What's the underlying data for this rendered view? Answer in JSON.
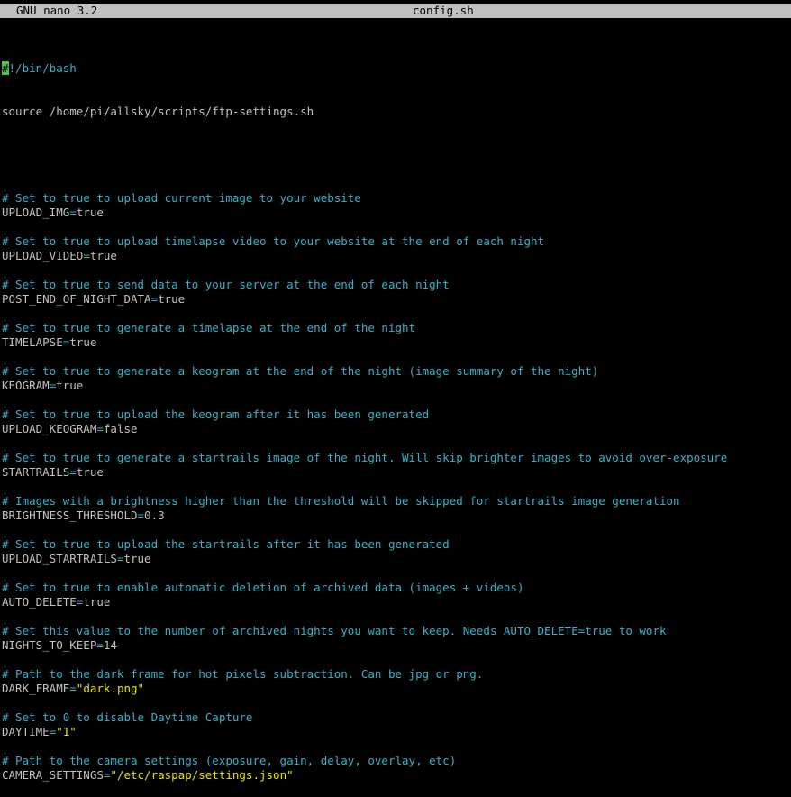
{
  "titlebar": {
    "app_name": "GNU nano 3.2",
    "file_name": "config.sh"
  },
  "editor": {
    "shebang_cursor": "#",
    "shebang_rest": "!/bin/bash",
    "source_line": "source /home/pi/allsky/scripts/ftp-settings.sh",
    "lines": [
      {
        "comment": "# Set to true to upload current image to your website"
      },
      {
        "key": "UPLOAD_IMG",
        "value": "true"
      },
      {
        "blank": true
      },
      {
        "comment": "# Set to true to upload timelapse video to your website at the end of each night"
      },
      {
        "key": "UPLOAD_VIDEO",
        "value": "true"
      },
      {
        "blank": true
      },
      {
        "comment": "# Set to true to send data to your server at the end of each night"
      },
      {
        "key": "POST_END_OF_NIGHT_DATA",
        "value": "true"
      },
      {
        "blank": true
      },
      {
        "comment": "# Set to true to generate a timelapse at the end of the night"
      },
      {
        "key": "TIMELAPSE",
        "value": "true"
      },
      {
        "blank": true
      },
      {
        "comment": "# Set to true to generate a keogram at the end of the night (image summary of the night)"
      },
      {
        "key": "KEOGRAM",
        "value": "true"
      },
      {
        "blank": true
      },
      {
        "comment": "# Set to true to upload the keogram after it has been generated"
      },
      {
        "key": "UPLOAD_KEOGRAM",
        "value": "false"
      },
      {
        "blank": true
      },
      {
        "comment": "# Set to true to generate a startrails image of the night. Will skip brighter images to avoid over-exposure"
      },
      {
        "key": "STARTRAILS",
        "value": "true"
      },
      {
        "blank": true
      },
      {
        "comment": "# Images with a brightness higher than the threshold will be skipped for startrails image generation"
      },
      {
        "key": "BRIGHTNESS_THRESHOLD",
        "value": "0.3"
      },
      {
        "blank": true
      },
      {
        "comment": "# Set to true to upload the startrails after it has been generated"
      },
      {
        "key": "UPLOAD_STARTRAILS",
        "value": "true"
      },
      {
        "blank": true
      },
      {
        "comment": "# Set to true to enable automatic deletion of archived data (images + videos)"
      },
      {
        "key": "AUTO_DELETE",
        "value": "true"
      },
      {
        "blank": true
      },
      {
        "comment": "# Set this value to the number of archived nights you want to keep. Needs AUTO_DELETE=true to work"
      },
      {
        "key": "NIGHTS_TO_KEEP",
        "value": "14"
      },
      {
        "blank": true
      },
      {
        "comment": "# Path to the dark frame for hot pixels subtraction. Can be jpg or png."
      },
      {
        "key": "DARK_FRAME",
        "value": "\"dark.png\"",
        "string": true
      },
      {
        "blank": true
      },
      {
        "comment": "# Set to 0 to disable Daytime Capture"
      },
      {
        "key": "DAYTIME",
        "value": "\"1\"",
        "string": true
      },
      {
        "blank": true
      },
      {
        "comment": "# Path to the camera settings (exposure, gain, delay, overlay, etc)"
      },
      {
        "key": "CAMERA_SETTINGS",
        "value": "\"/etc/raspap/settings.json\"",
        "string": true
      }
    ]
  },
  "colors": {
    "background": "#000000",
    "titlebar": "#c0c0c0",
    "text": "#c0c0c0",
    "comment": "#3cb0c4",
    "string": "#e6e600",
    "cursor": "#4ec24e"
  }
}
